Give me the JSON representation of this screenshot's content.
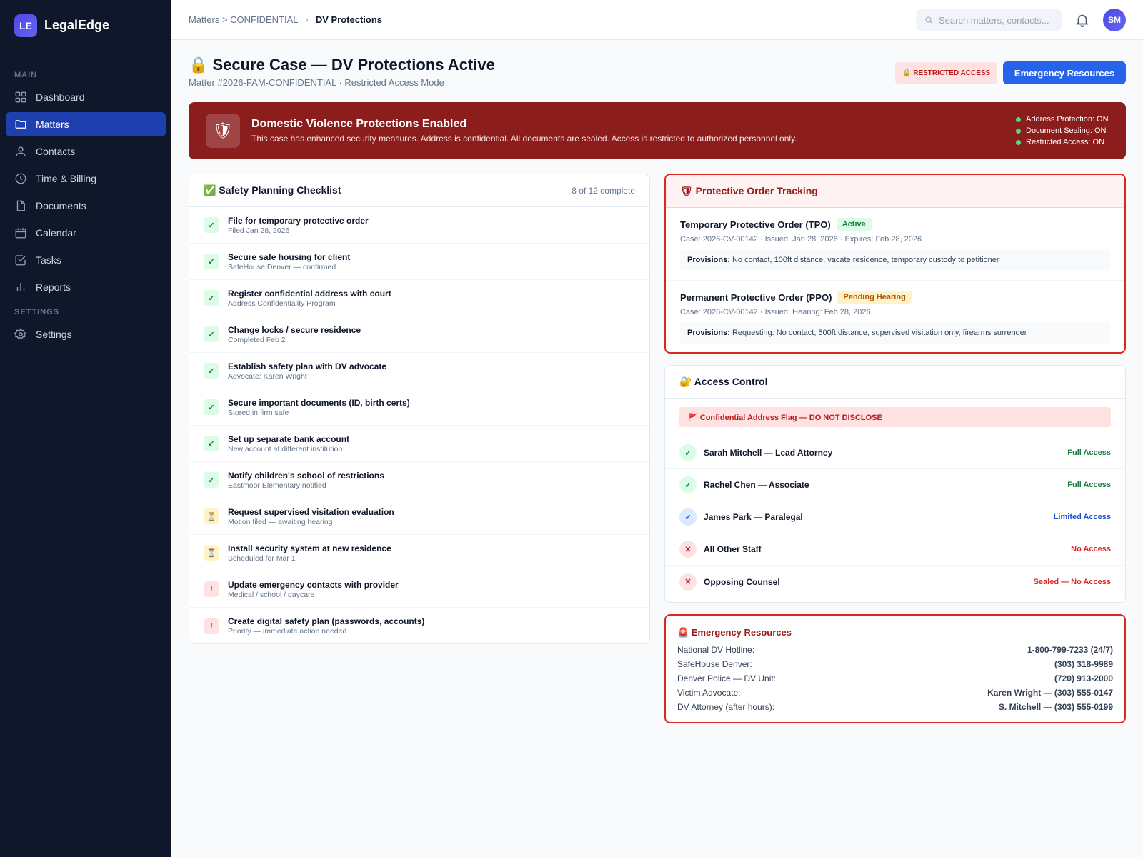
{
  "app": {
    "logo": "LE",
    "name": "LegalEdge"
  },
  "sidebar": {
    "main_label": "MAIN",
    "settings_label": "SETTINGS",
    "items": [
      {
        "label": "Dashboard",
        "icon": "grid-icon"
      },
      {
        "label": "Matters",
        "icon": "folder-icon",
        "active": true
      },
      {
        "label": "Contacts",
        "icon": "user-icon"
      },
      {
        "label": "Time & Billing",
        "icon": "clock-icon"
      },
      {
        "label": "Documents",
        "icon": "file-icon"
      },
      {
        "label": "Calendar",
        "icon": "calendar-icon"
      },
      {
        "label": "Tasks",
        "icon": "check-square-icon"
      },
      {
        "label": "Reports",
        "icon": "bar-chart-icon"
      }
    ],
    "settings_item": {
      "label": "Settings",
      "icon": "gear-icon"
    }
  },
  "topbar": {
    "breadcrumb": {
      "parent": "Matters > CONFIDENTIAL",
      "separator": "›",
      "current": "DV Protections"
    },
    "search_placeholder": "Search matters, contacts...",
    "avatar_initials": "SM"
  },
  "header": {
    "title": "🔒 Secure Case — DV Protections Active",
    "subtitle": "Matter #2026-FAM-CONFIDENTIAL · Restricted Access Mode",
    "badge": "🔒 RESTRICTED ACCESS",
    "button": "Emergency Resources"
  },
  "banner": {
    "icon": "🛡",
    "title": "Domestic Violence Protections Enabled",
    "text": "This case has enhanced security measures. Address is confidential. All documents are sealed. Access is restricted to authorized personnel only.",
    "statuses": [
      "Address Protection: ON",
      "Document Sealing: ON",
      "Restricted Access: ON"
    ]
  },
  "checklist": {
    "title": "✅ Safety Planning Checklist",
    "progress": "8 of 12 complete",
    "items": [
      {
        "title": "File for temporary protective order",
        "sub": "Filed Jan 28, 2026",
        "status": "done",
        "mark": "✓"
      },
      {
        "title": "Secure safe housing for client",
        "sub": "SafeHouse Denver — confirmed",
        "status": "done",
        "mark": "✓"
      },
      {
        "title": "Register confidential address with court",
        "sub": "Address Confidentiality Program",
        "status": "done",
        "mark": "✓"
      },
      {
        "title": "Change locks / secure residence",
        "sub": "Completed Feb 2",
        "status": "done",
        "mark": "✓"
      },
      {
        "title": "Establish safety plan with DV advocate",
        "sub": "Advocate: Karen Wright",
        "status": "done",
        "mark": "✓"
      },
      {
        "title": "Secure important documents (ID, birth certs)",
        "sub": "Stored in firm safe",
        "status": "done",
        "mark": "✓"
      },
      {
        "title": "Set up separate bank account",
        "sub": "New account at different institution",
        "status": "done",
        "mark": "✓"
      },
      {
        "title": "Notify children's school of restrictions",
        "sub": "Eastmoor Elementary notified",
        "status": "done",
        "mark": "✓"
      },
      {
        "title": "Request supervised visitation evaluation",
        "sub": "Motion filed — awaiting hearing",
        "status": "pending",
        "mark": "⏳"
      },
      {
        "title": "Install security system at new residence",
        "sub": "Scheduled for Mar 1",
        "status": "pending",
        "mark": "⏳"
      },
      {
        "title": "Update emergency contacts with provider",
        "sub": "Medical / school / daycare",
        "status": "urgent",
        "mark": "!"
      },
      {
        "title": "Create digital safety plan (passwords, accounts)",
        "sub": "Priority — immediate action needed",
        "status": "urgent",
        "mark": "!"
      }
    ]
  },
  "orders": {
    "title": "🛡 Protective Order Tracking",
    "items": [
      {
        "title": "Temporary Protective Order (TPO)",
        "badge": "Active",
        "meta": "Case: 2026-CV-00142 · Issued: Jan 28, 2026 · Expires: Feb 28, 2026",
        "provisions_label": "Provisions:",
        "provisions": "No contact, 100ft distance, vacate residence, temporary custody to petitioner"
      },
      {
        "title": "Permanent Protective Order (PPO)",
        "badge": "Pending Hearing",
        "meta": "Case: 2026-CV-00142 · Issued: Hearing: Feb 28, 2026",
        "provisions_label": "Provisions:",
        "provisions": "Requesting: No contact, 500ft distance, supervised visitation only, firearms surrender"
      }
    ]
  },
  "access": {
    "title": "🔐 Access Control",
    "flag": "🚩 Confidential Address Flag — DO NOT DISCLOSE",
    "rows": [
      {
        "name": "Sarah Mitchell — Lead Attorney",
        "level": "Full Access",
        "type": "full",
        "mark": "✓"
      },
      {
        "name": "Rachel Chen — Associate",
        "level": "Full Access",
        "type": "full",
        "mark": "✓"
      },
      {
        "name": "James Park — Paralegal",
        "level": "Limited Access",
        "type": "limited",
        "mark": "✓"
      },
      {
        "name": "All Other Staff",
        "level": "No Access",
        "type": "none",
        "mark": "✕"
      },
      {
        "name": "Opposing Counsel",
        "level": "Sealed — No Access",
        "type": "none",
        "mark": "✕"
      }
    ]
  },
  "resources": {
    "title": "🚨 Emergency Resources",
    "rows": [
      {
        "label": "National DV Hotline:",
        "value": "1-800-799-7233 (24/7)"
      },
      {
        "label": "SafeHouse Denver:",
        "value": "(303) 318-9989"
      },
      {
        "label": "Denver Police — DV Unit:",
        "value": "(720) 913-2000"
      },
      {
        "label": "Victim Advocate:",
        "value": "Karen Wright — (303) 555-0147"
      },
      {
        "label": "DV Attorney (after hours):",
        "value": "S. Mitchell — (303) 555-0199"
      }
    ]
  },
  "colors": {
    "sidebar_bg": "#0f172a",
    "accent": "#2563eb",
    "banner_bg": "#8b1d1d",
    "danger": "#dc2626",
    "success": "#15803d"
  }
}
